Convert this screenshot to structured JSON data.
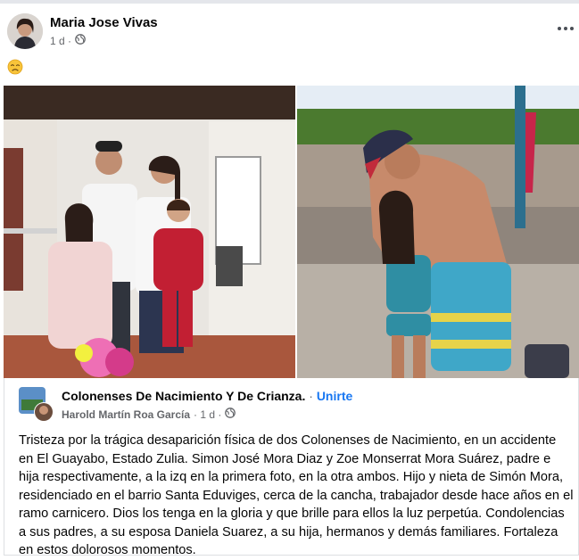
{
  "post": {
    "author": "Maria Jose Vivas",
    "time": "1 d ·",
    "emoji_icon": "weary-face-emoji-icon"
  },
  "shared_post": {
    "group_name": "Colonenses De Nacimiento Y De Crianza.",
    "separator": "·",
    "join_label": "Unirte",
    "author": "Harold Martín Roa García",
    "time": "· 1 d ·",
    "text": "Tristeza por la trágica desaparición física de dos Colonenses de Nacimiento, en un accidente en El Guayabo, Estado Zulia. Simon José Mora Diaz y Zoe Monserrat Mora  Suárez, padre e hija respectivamente, a la izq en la primera foto, en la otra ambos. Hijo y nieta de Simón Mora, residenciado en el barrio Santa Eduviges, cerca de la cancha, trabajador desde hace años en el ramo carnicero. Dios los tenga en la gloria y que brille para ellos la luz perpetúa. Condolencias a sus padres,  a su esposa Daniela Suarez, a su hija, hermanos y demás familiares. Fortaleza en estos dolorosos momentos."
  },
  "colors": {
    "accent": "#1877f2",
    "secondary_text": "#65676b",
    "border": "#dddfe2"
  }
}
